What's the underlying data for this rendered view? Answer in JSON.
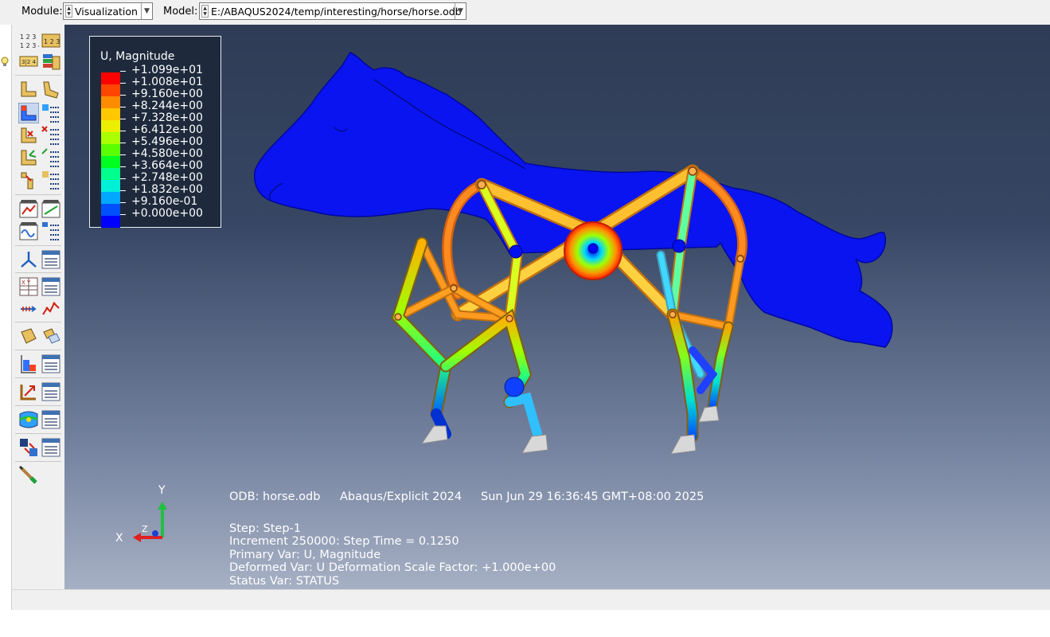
{
  "topbar": {
    "module_label": "Module:",
    "module_value": "Visualization",
    "model_label": "Model:",
    "model_value": "E:/ABAQUS2024/temp/interesting/horse/horse.odb"
  },
  "toolbox": {
    "icons": [
      "plot-undeformed-icon",
      "plot-deformed-icon",
      "plot-contours-icon",
      "plot-symbols-icon",
      "plot-material-orientations-icon",
      "animate-icon",
      "xy-data-icon",
      "query-icon",
      "display-group-icon",
      "view-cut-icon",
      "color-code-icon",
      "common-options-icon"
    ]
  },
  "legend": {
    "title": "U, Magnitude",
    "entries": [
      {
        "value": "+1.099e+01",
        "color": "#ff0000"
      },
      {
        "value": "+1.008e+01",
        "color": "#ff4600"
      },
      {
        "value": "+9.160e+00",
        "color": "#ff8c00"
      },
      {
        "value": "+8.244e+00",
        "color": "#ffc800"
      },
      {
        "value": "+7.328e+00",
        "color": "#ecef00"
      },
      {
        "value": "+6.412e+00",
        "color": "#aaff00"
      },
      {
        "value": "+5.496e+00",
        "color": "#5aff00"
      },
      {
        "value": "+4.580e+00",
        "color": "#00ff20"
      },
      {
        "value": "+3.664e+00",
        "color": "#00ff8c"
      },
      {
        "value": "+2.748e+00",
        "color": "#00f0d8"
      },
      {
        "value": "+1.832e+00",
        "color": "#00a8ff"
      },
      {
        "value": "+9.160e-01",
        "color": "#0050ff"
      },
      {
        "value": "+0.000e+00",
        "color": "#0000ff"
      }
    ]
  },
  "viewport_info": {
    "odb": "ODB: horse.odb",
    "solver": "Abaqus/Explicit 2024",
    "date": "Sun Jun 29 16:36:45 GMT+08:00 2025",
    "step": "Step: Step-1",
    "increment": "Increment    250000: Step Time =    0.1250",
    "primary_var": "Primary Var: U, Magnitude",
    "deformed_var": "Deformed Var: U   Deformation Scale Factor: +1.000e+00",
    "status_var": "Status Var: STATUS"
  },
  "triad": {
    "x": "X",
    "y": "Y",
    "z": "Z"
  }
}
